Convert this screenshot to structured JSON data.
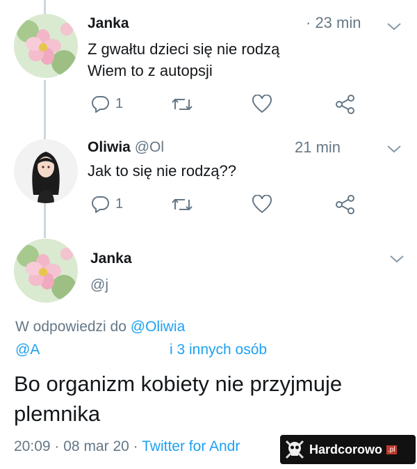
{
  "tweets": [
    {
      "name": "Janka",
      "handle": "",
      "time": "· 23 min",
      "lines": [
        "Z gwałtu dzieci się nie rodzą",
        "Wiem to z autopsji"
      ],
      "reply_count": "1"
    },
    {
      "name": "Oliwia",
      "handle": "@Ol",
      "time": "21 min",
      "lines": [
        "Jak to się nie rodzą??"
      ],
      "reply_count": "1"
    }
  ],
  "main_tweet": {
    "name": "Janka",
    "handle": "@j",
    "reply_prefix": "W odpowiedzi do",
    "reply_to": "@Oliwia",
    "reply_second": "@A",
    "reply_others": "i 3 innych osób",
    "body_lines": [
      "Bo organizm kobiety nie przyjmuje",
      "plemnika"
    ],
    "meta_time": "20:09",
    "meta_date": "08 mar 20",
    "meta_source": "Twitter for Andr"
  },
  "watermark": {
    "text": "Hardcorowo",
    "suffix": ".pl"
  },
  "colors": {
    "accent": "#1da1f2",
    "muted": "#657786",
    "line": "#ccd6dd"
  }
}
